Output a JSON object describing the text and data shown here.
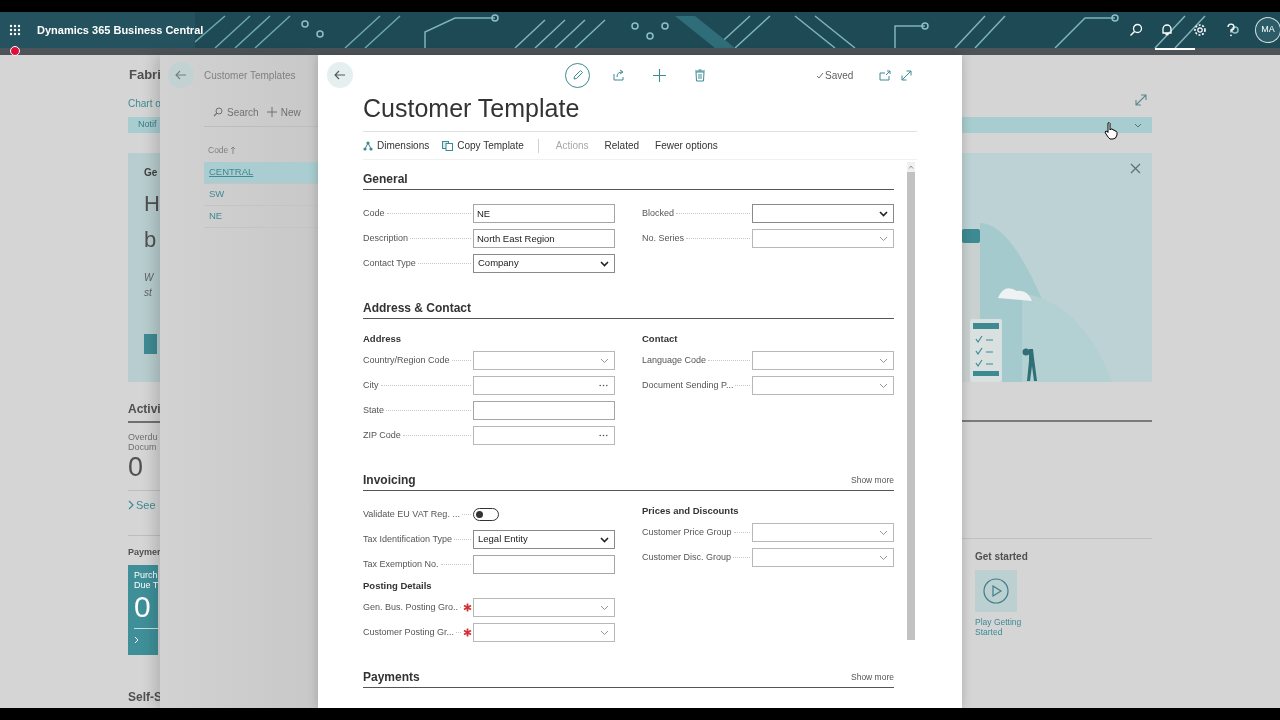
{
  "app_bar": {
    "title": "Dynamics 365 Business Central",
    "avatar": "MA"
  },
  "background_page": {
    "title": "Fabri",
    "link": "Chart o",
    "notification": "Notif",
    "headline_card": {
      "heading": "Ge",
      "headline_lines": [
        "H",
        "b"
      ],
      "subtitle_lines": [
        "W",
        "st"
      ]
    },
    "activities": {
      "title": "Activi",
      "cue_caption_lines": [
        "Overdu",
        "Docum"
      ],
      "cue_value": "0",
      "see_more": "See"
    },
    "payments": {
      "title": "Paymer",
      "tile_caption_lines": [
        "Purch",
        "Due T"
      ],
      "tile_value": "0"
    },
    "self_service_title": "Self-S",
    "get_started": {
      "title": "Get started",
      "tile_label": "Play Getting Started"
    }
  },
  "list_page": {
    "title": "Customer Templates",
    "actions": [
      {
        "label": "Search",
        "kind": "search"
      },
      {
        "label": "New",
        "kind": "new"
      }
    ],
    "column": "Code",
    "rows": [
      {
        "code": "CENTRAL",
        "selected": true
      },
      {
        "code": "SW",
        "selected": false
      },
      {
        "code": "NE",
        "selected": false
      }
    ]
  },
  "card": {
    "title": "Customer Template",
    "status": "Saved",
    "actions": [
      {
        "label": "Dimensions",
        "kind": "dimensions"
      },
      {
        "label": "Copy Template",
        "kind": "copy"
      }
    ],
    "menus": [
      {
        "label": "Actions",
        "disabled": true
      },
      {
        "label": "Related",
        "disabled": false
      },
      {
        "label": "Fewer options",
        "disabled": false
      }
    ],
    "sections": [
      {
        "title": "General",
        "columns": [
          {
            "items": [
              {
                "kind": "text",
                "label": "Code",
                "value": "NE",
                "required": false
              },
              {
                "kind": "text",
                "label": "Description",
                "value": "North East Region",
                "required": false
              },
              {
                "kind": "select",
                "label": "Contact Type",
                "value": "Company",
                "required": false
              }
            ]
          },
          {
            "items": [
              {
                "kind": "select",
                "label": "Blocked",
                "required": false
              },
              {
                "kind": "lookup",
                "label": "No. Series",
                "required": false
              }
            ]
          }
        ]
      },
      {
        "title": "Address & Contact",
        "columns": [
          {
            "items": [
              {
                "kind": "subheading",
                "label": "Address"
              },
              {
                "kind": "lookup",
                "label": "Country/Region Code",
                "required": false
              },
              {
                "kind": "assist",
                "label": "City",
                "required": false
              },
              {
                "kind": "text",
                "label": "State",
                "required": false
              },
              {
                "kind": "assist",
                "label": "ZIP Code",
                "required": false
              }
            ]
          },
          {
            "items": [
              {
                "kind": "subheading",
                "label": "Contact"
              },
              {
                "kind": "lookup",
                "label": "Language Code",
                "required": false
              },
              {
                "kind": "lookup",
                "label": "Document Sending P...",
                "required": false
              }
            ]
          }
        ]
      },
      {
        "title": "Invoicing",
        "more": "Show more",
        "columns": [
          {
            "items": [
              {
                "kind": "toggle",
                "label": "Validate EU VAT Reg. ...",
                "on": false,
                "required": false
              },
              {
                "kind": "select",
                "label": "Tax Identification Type",
                "value": "Legal Entity",
                "required": false
              },
              {
                "kind": "text",
                "label": "Tax Exemption No.",
                "required": false
              },
              {
                "kind": "subheading",
                "label": "Posting Details"
              },
              {
                "kind": "lookup",
                "label": "Gen. Bus. Posting Gro..",
                "required": true
              },
              {
                "kind": "lookup",
                "label": "Customer Posting Gr...",
                "required": true
              }
            ]
          },
          {
            "items": [
              {
                "kind": "subheading",
                "label": "Prices and Discounts"
              },
              {
                "kind": "lookup",
                "label": "Customer Price Group",
                "required": false
              },
              {
                "kind": "lookup",
                "label": "Customer Disc. Group",
                "required": false
              }
            ]
          }
        ]
      },
      {
        "title": "Payments",
        "more": "Show more"
      }
    ]
  }
}
